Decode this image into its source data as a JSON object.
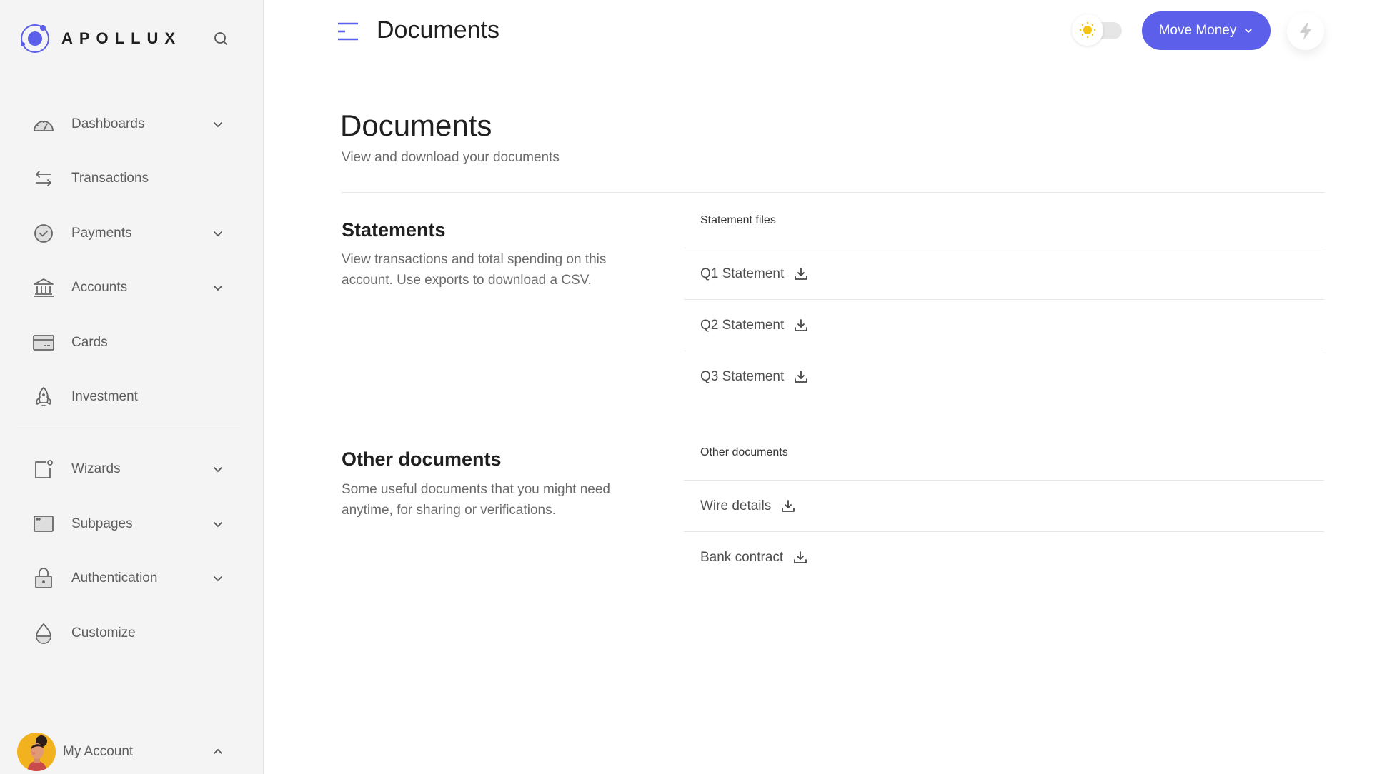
{
  "brand": {
    "name": "APOLLUX",
    "accent": "#5b5fea"
  },
  "sidebar": {
    "search_icon": "search-icon",
    "items": [
      {
        "label": "Dashboards",
        "icon": "gauge-icon",
        "has_chevron": true
      },
      {
        "label": "Transactions",
        "icon": "swap-arrows-icon",
        "has_chevron": false
      },
      {
        "label": "Payments",
        "icon": "check-circle-icon",
        "has_chevron": true
      },
      {
        "label": "Accounts",
        "icon": "bank-icon",
        "has_chevron": true
      },
      {
        "label": "Cards",
        "icon": "credit-card-icon",
        "has_chevron": false
      },
      {
        "label": "Investment",
        "icon": "rocket-icon",
        "has_chevron": false
      },
      {
        "label": "Wizards",
        "icon": "notification-square-icon",
        "has_chevron": true
      },
      {
        "label": "Subpages",
        "icon": "browser-window-icon",
        "has_chevron": true
      },
      {
        "label": "Authentication",
        "icon": "lock-icon",
        "has_chevron": true
      },
      {
        "label": "Customize",
        "icon": "drop-icon",
        "has_chevron": false
      }
    ],
    "account": {
      "label": "My Account",
      "expanded": true
    }
  },
  "topbar": {
    "title": "Documents",
    "theme": "light",
    "move_money_label": "Move Money"
  },
  "page": {
    "title": "Documents",
    "subtitle": "View and download your documents",
    "sections": [
      {
        "title": "Statements",
        "description": "View transactions and total spending on this account. Use exports to download a CSV.",
        "list_header": "Statement files",
        "files": [
          "Q1 Statement",
          "Q2 Statement",
          "Q3 Statement"
        ]
      },
      {
        "title": "Other documents",
        "description": "Some useful documents that you might need anytime, for sharing or verifications.",
        "list_header": "Other documents",
        "files": [
          "Wire details",
          "Bank contract"
        ]
      }
    ]
  }
}
